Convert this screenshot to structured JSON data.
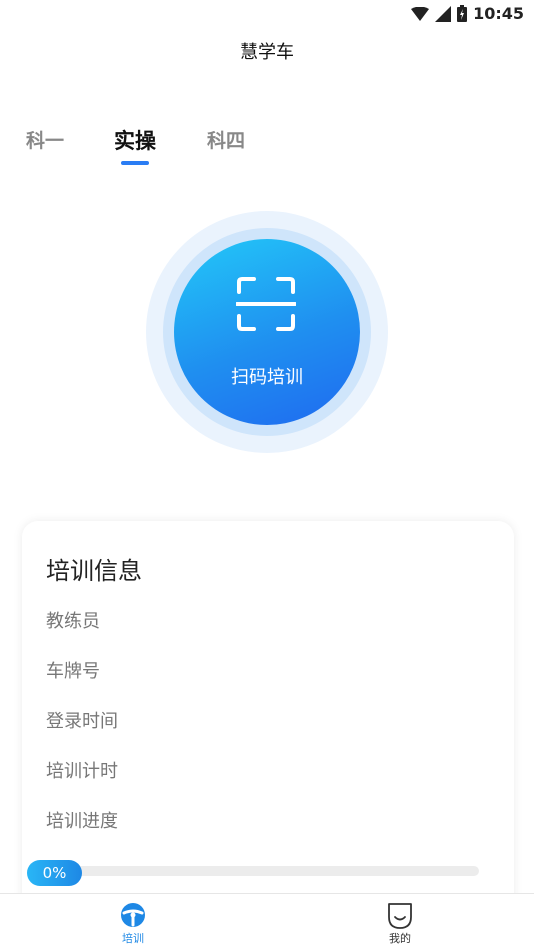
{
  "status_bar": {
    "time": "10:45"
  },
  "app": {
    "title": "慧学车"
  },
  "tabs": [
    {
      "label": "科一"
    },
    {
      "label": "实操"
    },
    {
      "label": "科四"
    }
  ],
  "scan": {
    "label": "扫码培训"
  },
  "info": {
    "title": "培训信息",
    "rows": [
      {
        "label": "教练员"
      },
      {
        "label": "车牌号"
      },
      {
        "label": "登录时间"
      },
      {
        "label": "培训计时"
      },
      {
        "label": "培训进度"
      }
    ],
    "progress_text": "0%",
    "progress_value": 0
  },
  "bottom_nav": [
    {
      "label": "培训",
      "icon": "steering-wheel-icon"
    },
    {
      "label": "我的",
      "icon": "smile-face-icon"
    }
  ],
  "colors": {
    "accent": "#2a7df4",
    "scan_gradient_start": "#23c8f8",
    "scan_gradient_end": "#1f6af0"
  }
}
